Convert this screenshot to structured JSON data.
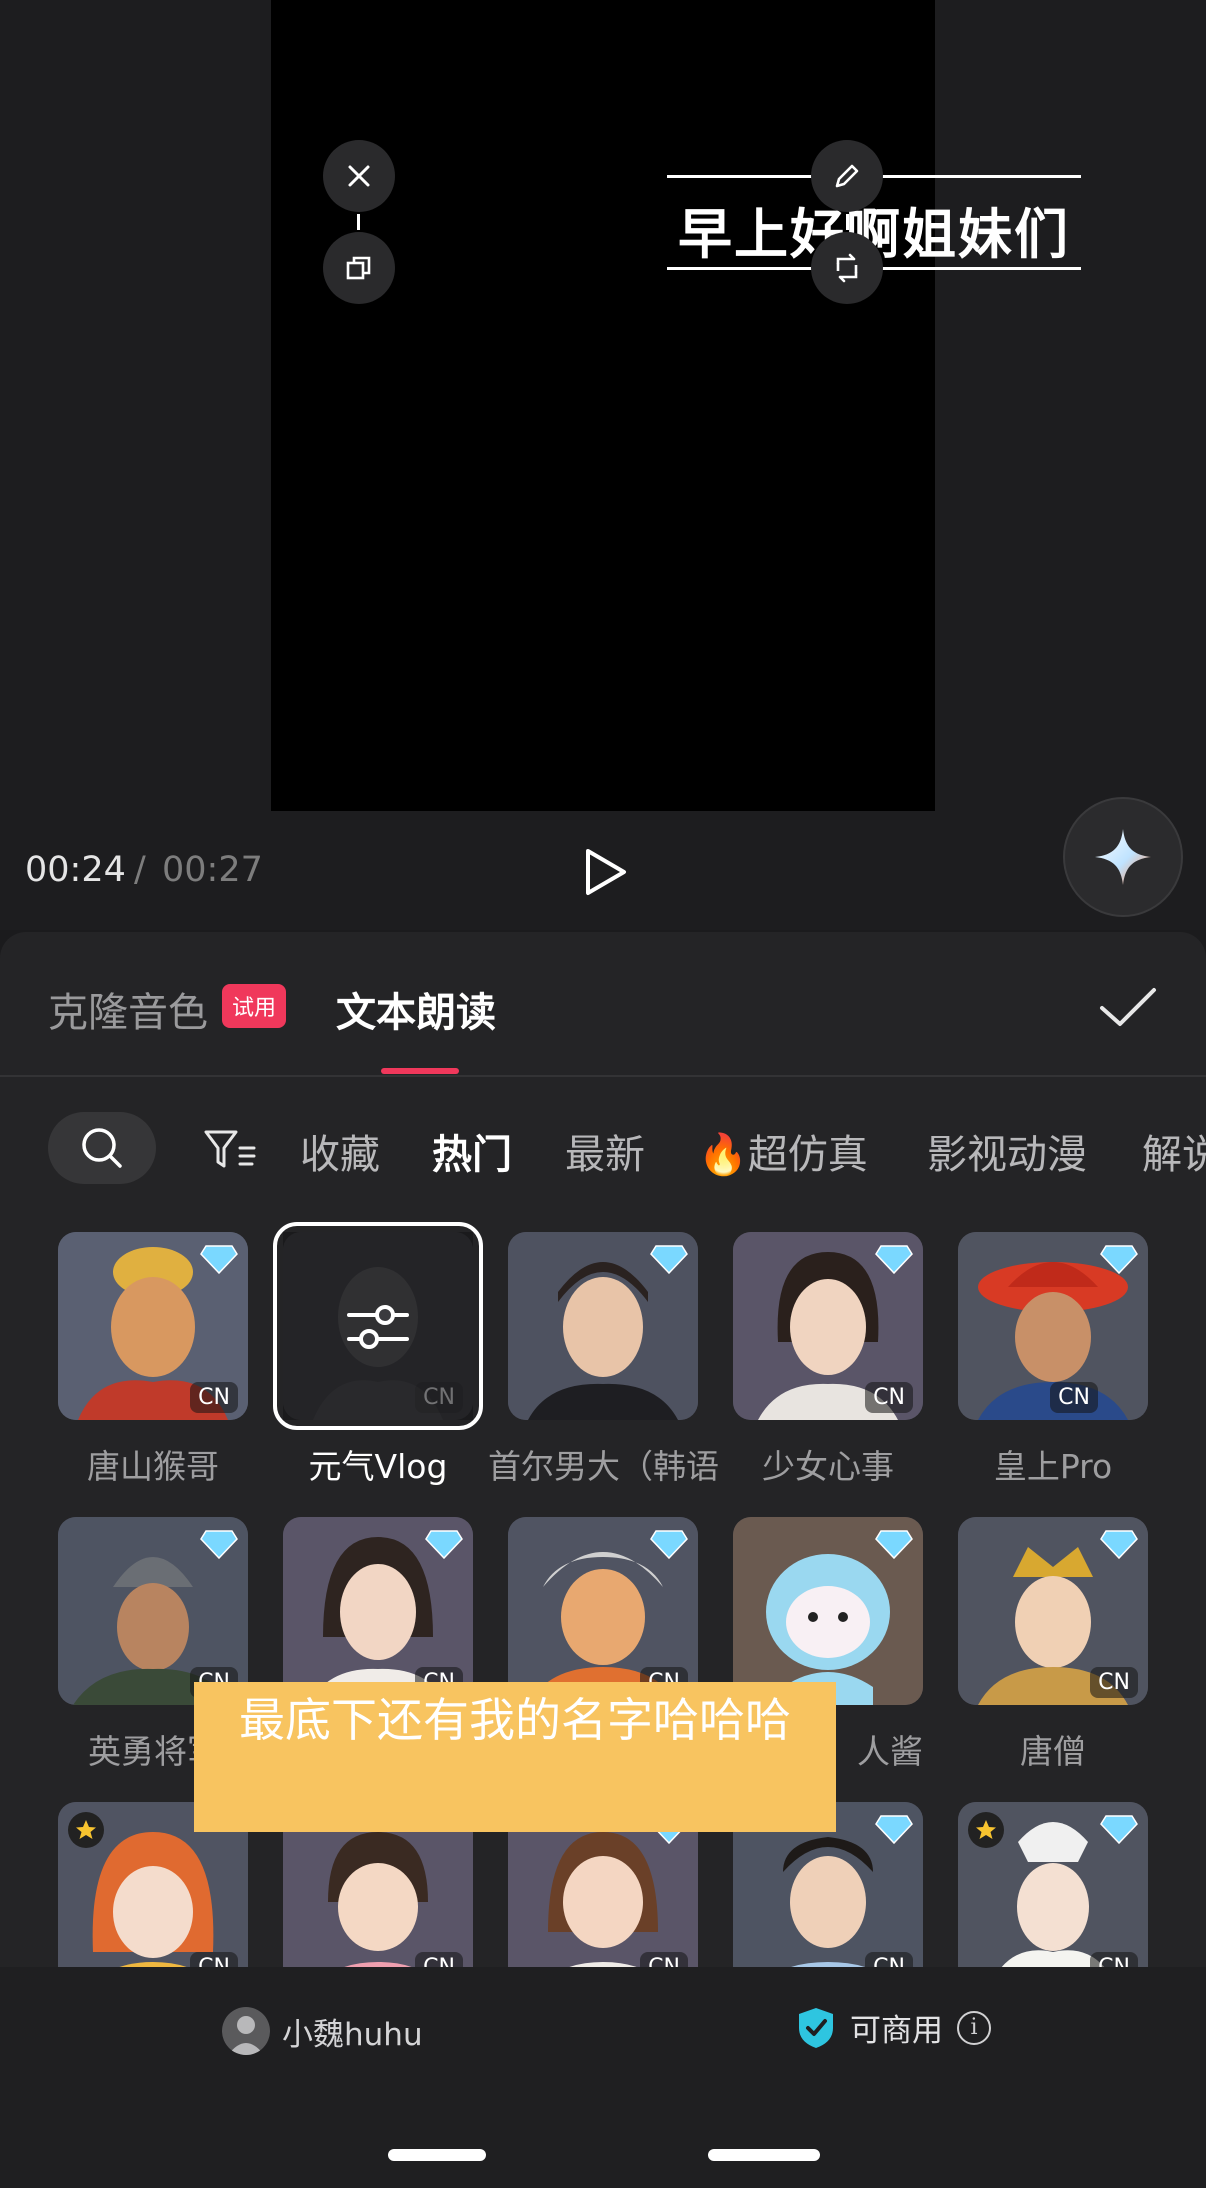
{
  "preview": {
    "caption": "早上好啊姐妹们",
    "current_time": "00:24",
    "separator": "/",
    "total_time": "00:27"
  },
  "panel": {
    "tabs": [
      {
        "label": "克隆音色",
        "badge": "试用"
      },
      {
        "label": "文本朗读",
        "active": true
      }
    ],
    "categories": [
      "收藏",
      "热门",
      "最新",
      "🔥超仿真",
      "影视动漫",
      "解说"
    ],
    "active_category": "热门",
    "voices": [
      {
        "name": "唐山猴哥",
        "badge": "CN",
        "premium": true
      },
      {
        "name": "元气Vlog",
        "badge": "CN",
        "premium": true,
        "selected": true
      },
      {
        "name": "首尔男大（韩语）",
        "premium": true
      },
      {
        "name": "少女心事",
        "badge": "CN",
        "premium": true
      },
      {
        "name": "皇上Pro",
        "badge": "CN",
        "premium": true
      },
      {
        "name": "英勇将军",
        "badge": "CN",
        "premium": true
      },
      {
        "name": "",
        "badge": "CN",
        "premium": true
      },
      {
        "name": "",
        "badge": "CN",
        "premium": true
      },
      {
        "name": "人酱",
        "premium": true
      },
      {
        "name": "唐僧",
        "badge": "CN",
        "premium": true
      },
      {
        "name": "",
        "badge": "CN",
        "favorite": true
      },
      {
        "name": "",
        "badge": "CN",
        "premium": true
      },
      {
        "name": "",
        "badge": "CN",
        "premium": true
      },
      {
        "name": "",
        "badge": "CN",
        "premium": true
      },
      {
        "name": "",
        "badge": "CN",
        "favorite": true,
        "premium": true
      }
    ]
  },
  "toast": "最底下还有我的名字哈哈哈",
  "footer": {
    "username": "小魏huhu",
    "commercial_label": "可商用",
    "info_icon": "i"
  },
  "colors": {
    "accent": "#f0385b",
    "toast_bg": "#f8c460",
    "shield": "#2ec5e0"
  }
}
